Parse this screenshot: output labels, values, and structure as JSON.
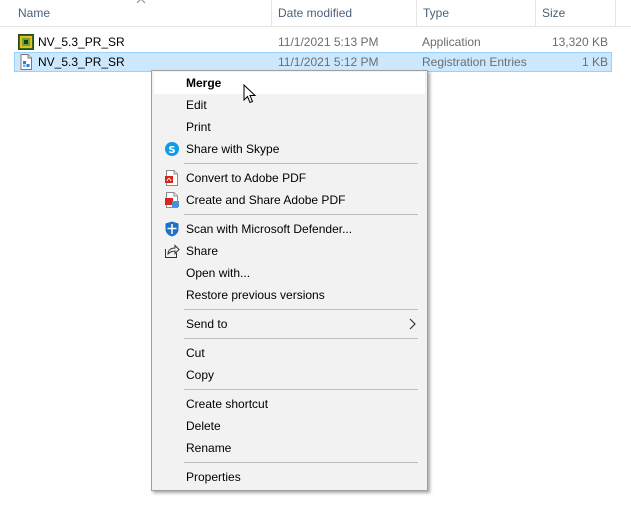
{
  "columns": {
    "name": "Name",
    "date": "Date modified",
    "type": "Type",
    "size": "Size"
  },
  "files": [
    {
      "name": "NV_5.3_PR_SR",
      "date": "11/1/2021 5:13 PM",
      "type": "Application",
      "size": "13,320 KB",
      "icon": "application-icon"
    },
    {
      "name": "NV_5.3_PR_SR",
      "date": "11/1/2021 5:12 PM",
      "type": "Registration Entries",
      "size": "1 KB",
      "icon": "registry-file-icon"
    }
  ],
  "context_menu": {
    "items": [
      {
        "label": "Merge"
      },
      {
        "label": "Edit"
      },
      {
        "label": "Print"
      },
      {
        "label": "Share with Skype",
        "icon": "skype-icon"
      },
      {
        "label": "Convert to Adobe PDF",
        "icon": "adobe-pdf-icon"
      },
      {
        "label": "Create and Share Adobe PDF",
        "icon": "adobe-pdf-share-icon"
      },
      {
        "label": "Scan with Microsoft Defender...",
        "icon": "defender-shield-icon"
      },
      {
        "label": "Share",
        "icon": "share-icon"
      },
      {
        "label": "Open with..."
      },
      {
        "label": "Restore previous versions"
      },
      {
        "label": "Send to"
      },
      {
        "label": "Cut"
      },
      {
        "label": "Copy"
      },
      {
        "label": "Create shortcut"
      },
      {
        "label": "Delete"
      },
      {
        "label": "Rename"
      },
      {
        "label": "Properties"
      }
    ]
  }
}
